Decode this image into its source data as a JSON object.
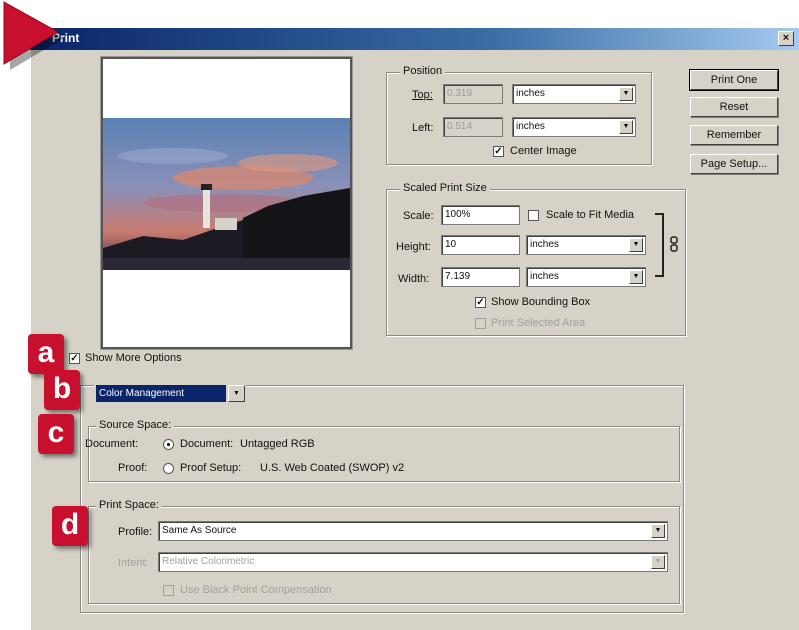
{
  "window": {
    "title": "Print",
    "close_glyph": "×"
  },
  "position": {
    "legend": "Position",
    "top_label": "Top:",
    "top_value": "0.319",
    "top_unit": "inches",
    "left_label": "Left:",
    "left_value": "0.514",
    "left_unit": "inches",
    "center_image_label": "Center Image",
    "center_image_checked": true
  },
  "buttons": {
    "print_one": "Print One",
    "reset": "Reset",
    "remember": "Remember",
    "page_setup": "Page Setup..."
  },
  "scaled": {
    "legend": "Scaled Print Size",
    "scale_label": "Scale:",
    "scale_value": "100%",
    "scale_to_fit_label": "Scale to Fit Media",
    "scale_to_fit_checked": false,
    "height_label": "Height:",
    "height_value": "10",
    "height_unit": "inches",
    "width_label": "Width:",
    "width_value": "7.139",
    "width_unit": "inches",
    "show_bounding_box_label": "Show Bounding Box",
    "show_bounding_box_checked": true,
    "print_selected_area_label": "Print Selected Area",
    "print_selected_area_checked": false
  },
  "more_options": {
    "label": "Show More Options",
    "checked": true
  },
  "color_management": {
    "selected": "Color Management"
  },
  "source_space": {
    "legend": "Source Space:",
    "document_row_label": "Document:",
    "document_option": "Document:",
    "document_value": "Untagged RGB",
    "proof_row_label": "Proof:",
    "proof_option": "Proof Setup:",
    "proof_value": "U.S. Web Coated (SWOP) v2"
  },
  "print_space": {
    "legend": "Print Space:",
    "profile_label": "Profile:",
    "profile_value": "Same As Source",
    "intent_label": "Intent:",
    "intent_value": "Relative Colorimetric",
    "bpc_label": "Use Black Point Compensation"
  },
  "markers": [
    "a",
    "b",
    "c",
    "d"
  ],
  "colors": {
    "titlebar": "#0a246a",
    "dialog": "#d6d2c8",
    "marker": "#c8102e",
    "highlight": "#0a246a"
  },
  "icons": {
    "dropdown": "chevron-down-icon",
    "link": "chain-link-icon",
    "pointer": "red-arrow-icon"
  }
}
